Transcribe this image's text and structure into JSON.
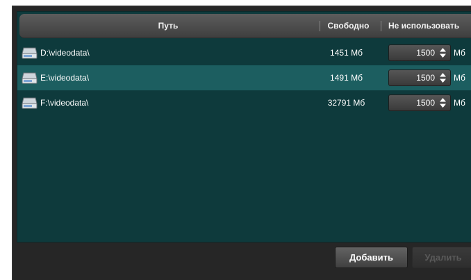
{
  "table": {
    "columns": {
      "path": "Путь",
      "free": "Свободно",
      "no_use": "Не использовать"
    },
    "rows": [
      {
        "path": "D:\\videodata\\",
        "free": "1451 Мб",
        "reserve": "1500",
        "unit": "Мб",
        "selected": false
      },
      {
        "path": "E:\\videodata\\",
        "free": "1491 Мб",
        "reserve": "1500",
        "unit": "Мб",
        "selected": true
      },
      {
        "path": "F:\\videodata\\",
        "free": "32791 Мб",
        "reserve": "1500",
        "unit": "Мб",
        "selected": false
      }
    ]
  },
  "buttons": {
    "add": "Добавить",
    "delete": "Удалить"
  },
  "icons": {
    "drive": "hard-drive-icon",
    "spinner": "up-down-arrows-icon"
  },
  "colors": {
    "panel_bg": "#0e3a3c",
    "selected_row": "#1c5e60",
    "frame_bg": "#262626"
  }
}
